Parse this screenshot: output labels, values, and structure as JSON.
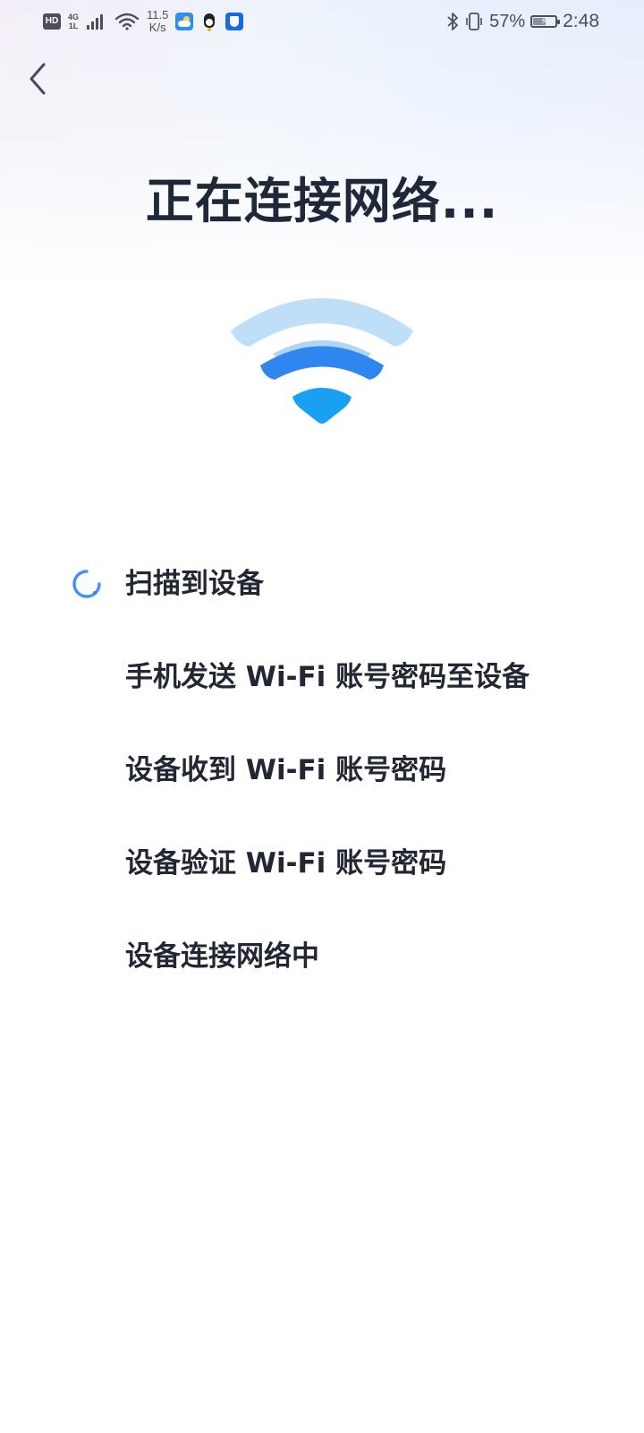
{
  "status_bar": {
    "hd": "HD",
    "network": "4G",
    "network_sub": "1L",
    "speed_value": "11.5",
    "speed_unit": "K/s",
    "battery_percent": "57%",
    "battery_level": 0.57,
    "time": "2:48",
    "icons": [
      "hd-icon",
      "signal-icon",
      "wifi-icon",
      "weather-app-icon",
      "qq-app-icon",
      "security-app-icon",
      "bluetooth-icon",
      "vibrate-icon",
      "battery-icon"
    ]
  },
  "header": {
    "back_icon": "chevron-left-icon",
    "title": "正在连接网络..."
  },
  "illustration": {
    "icon": "wifi-icon",
    "colors": {
      "outer_arc": "#bcdcf7",
      "middle_arc": "#2f86ef",
      "inner_arc": "#1aa0f2"
    }
  },
  "steps": [
    {
      "label": "扫描到设备",
      "state": "in-progress"
    },
    {
      "label": "手机发送 Wi-Fi 账号密码至设备",
      "state": "pending"
    },
    {
      "label": "设备收到 Wi-Fi 账号密码",
      "state": "pending"
    },
    {
      "label": "设备验证 Wi-Fi 账号密码",
      "state": "pending"
    },
    {
      "label": "设备连接网络中",
      "state": "pending"
    }
  ],
  "colors": {
    "accent": "#2f86ef",
    "text": "#222733"
  }
}
